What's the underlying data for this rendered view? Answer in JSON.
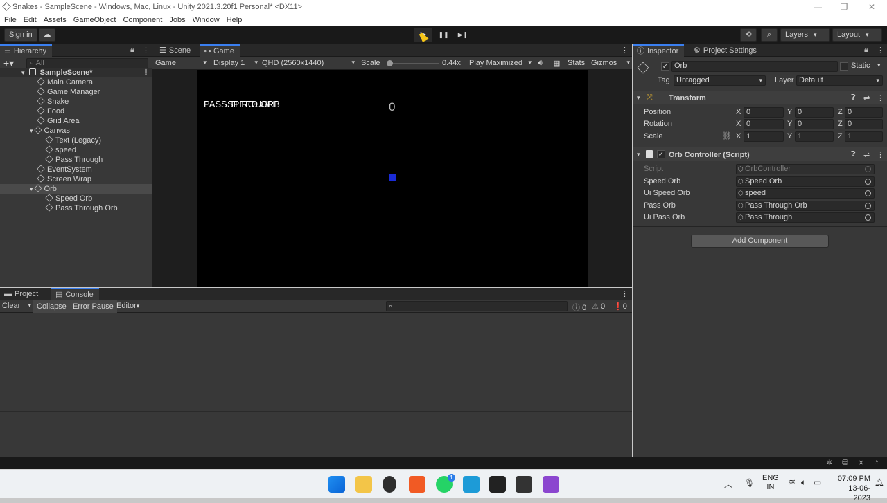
{
  "window": {
    "title": "Snakes - SampleScene - Windows, Mac, Linux - Unity 2021.3.20f1 Personal* <DX11>",
    "minimize": "—",
    "maximize": "❐",
    "close": "✕"
  },
  "menu": [
    "File",
    "Edit",
    "Assets",
    "GameObject",
    "Component",
    "Jobs",
    "Window",
    "Help"
  ],
  "toolbar": {
    "sign_in": "Sign in",
    "layers": "Layers",
    "layout": "Layout",
    "play": "▶",
    "pause": "❚❚",
    "step": "▶❙"
  },
  "hierarchy": {
    "tab": "Hierarchy",
    "search_placeholder": "All",
    "scene": "SampleScene*",
    "items": [
      {
        "label": "Main Camera"
      },
      {
        "label": "Game Manager"
      },
      {
        "label": "Snake"
      },
      {
        "label": "Food"
      },
      {
        "label": "Grid Area"
      },
      {
        "label": "Canvas"
      },
      {
        "label": "Text (Legacy)"
      },
      {
        "label": "speed"
      },
      {
        "label": "Pass Through"
      },
      {
        "label": "EventSystem"
      },
      {
        "label": "Screen Wrap"
      },
      {
        "label": "Orb"
      },
      {
        "label": "Speed Orb"
      },
      {
        "label": "Pass Through Orb"
      }
    ]
  },
  "game_view": {
    "tabs": [
      "Scene",
      "Game"
    ],
    "mode": "Game",
    "display": "Display 1",
    "resolution": "QHD (2560x1440)",
    "scale_label": "Scale",
    "scale_value": "0.44x",
    "scale_level": 0.05,
    "play_mode": "Play Maximized",
    "stats": "Stats",
    "gizmos": "Gizmos",
    "overlay_text_1": "PASS THROUGH",
    "overlay_text_2": "SPEED ORB",
    "score": "0",
    "orb_color": "#1a2bd6"
  },
  "console": {
    "tabs": [
      "Project",
      "Console"
    ],
    "clear": "Clear",
    "collapse": "Collapse",
    "error_pause": "Error Pause",
    "editor": "Editor",
    "info_count": "0",
    "warning_count": "0",
    "error_count": "0"
  },
  "inspector": {
    "tabs": [
      "Inspector",
      "Project Settings"
    ],
    "object_name": "Orb",
    "static_label": "Static",
    "tag_label": "Tag",
    "tag_value": "Untagged",
    "layer_label": "Layer",
    "layer_value": "Default",
    "transform": {
      "title": "Transform",
      "position_label": "Position",
      "rotation_label": "Rotation",
      "scale_label": "Scale",
      "position": [
        "0",
        "0",
        "0"
      ],
      "rotation": [
        "0",
        "0",
        "0"
      ],
      "scale": [
        "1",
        "1",
        "1"
      ],
      "axes": [
        "X",
        "Y",
        "Z"
      ]
    },
    "script_component": {
      "title": "Orb Controller (Script)",
      "fields": [
        {
          "label": "Script",
          "value": "OrbController"
        },
        {
          "label": "Speed Orb",
          "value": "Speed Orb"
        },
        {
          "label": "Ui Speed Orb",
          "value": "speed"
        },
        {
          "label": "Pass Orb",
          "value": "Pass Through Orb"
        },
        {
          "label": "Ui Pass Orb",
          "value": "Pass Through"
        }
      ]
    },
    "add_component": "Add Component"
  },
  "taskbar": {
    "language": "ENG",
    "region": "IN",
    "time": "07:09 PM",
    "date": "13-06-2023",
    "whatsapp_badge": "1"
  },
  "colors": {
    "accent": "#3a7ff0",
    "panel": "#383838",
    "game_bg": "#000000"
  }
}
